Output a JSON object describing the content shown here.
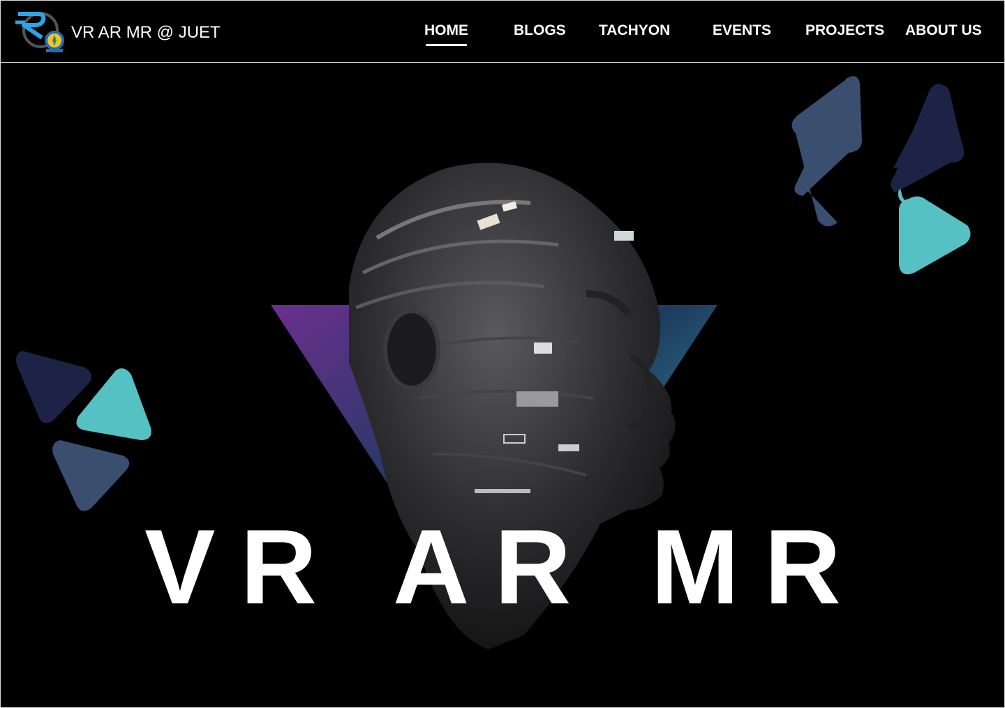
{
  "app": {
    "site_name": "VR AR MR @ JUET",
    "logo_alt_text": "JUET"
  },
  "nav": {
    "items": [
      {
        "label": "HOME",
        "active": true
      },
      {
        "label": "BLOGS",
        "active": false
      },
      {
        "label": "TACHYON",
        "active": false
      },
      {
        "label": "EVENTS",
        "active": false
      },
      {
        "label": "PROJECTS",
        "active": false
      },
      {
        "label": "ABOUT US",
        "active": false
      }
    ]
  },
  "hero": {
    "title": "VR AR MR"
  },
  "colors": {
    "background": "#000000",
    "navy": "#1d2347",
    "slate": "#3a4e70",
    "teal": "#55c1c3",
    "brand_blue": "#2aa5e8"
  },
  "icons": {
    "logo": "juet-vr-logo",
    "decor": "rounded-triangle-shapes"
  }
}
